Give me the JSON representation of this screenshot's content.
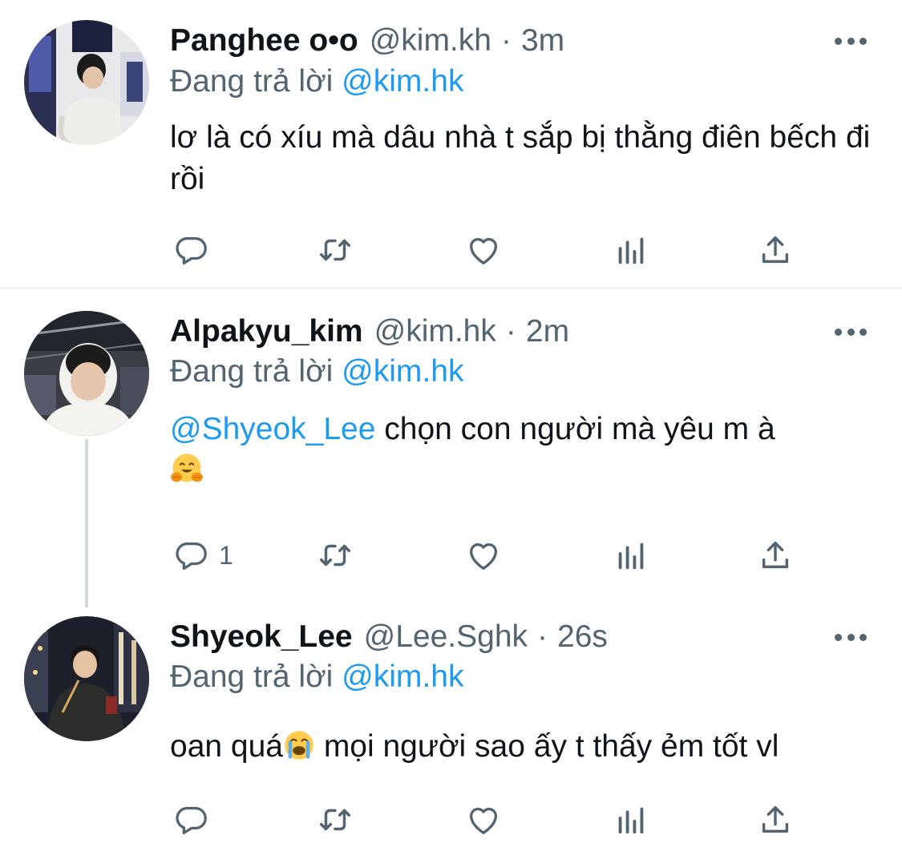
{
  "tweets": [
    {
      "name": "Panghee o•o",
      "handle": "@kim.kh",
      "time": "3m",
      "reply_prefix": "Đang trả lời ",
      "reply_mention": "@kim.hk",
      "text": "lơ là có xíu mà dâu nhà t sắp bị thằng điên bếch đi rồi",
      "reply_count": ""
    },
    {
      "name": "Alpakyu_kim",
      "handle": "@kim.hk",
      "time": "2m",
      "reply_prefix": "Đang trả lời ",
      "reply_mention": "@kim.hk",
      "text_mention": "@Shyeok_Lee",
      "text": " chọn con người mà yêu m à",
      "emoji": "hugging-face",
      "reply_count": "1"
    },
    {
      "name": "Shyeok_Lee",
      "handle": "@Lee.Sghk",
      "time": "26s",
      "reply_prefix": "Đang trả lời ",
      "reply_mention": "@kim.hk",
      "text_before": "oan quá",
      "emoji": "loudly-crying-face",
      "text_after": " mọi người sao ấy t thấy ẻm tốt vl",
      "reply_count": ""
    }
  ],
  "separator": "·",
  "icons": [
    "reply-icon",
    "retweet-icon",
    "like-icon",
    "analytics-icon",
    "share-icon",
    "more-icon"
  ],
  "colors": {
    "text": "#0f1419",
    "secondary": "#536471",
    "link": "#1d9bf0",
    "divider": "#eff3f4",
    "thread_line": "#cfd9de"
  }
}
